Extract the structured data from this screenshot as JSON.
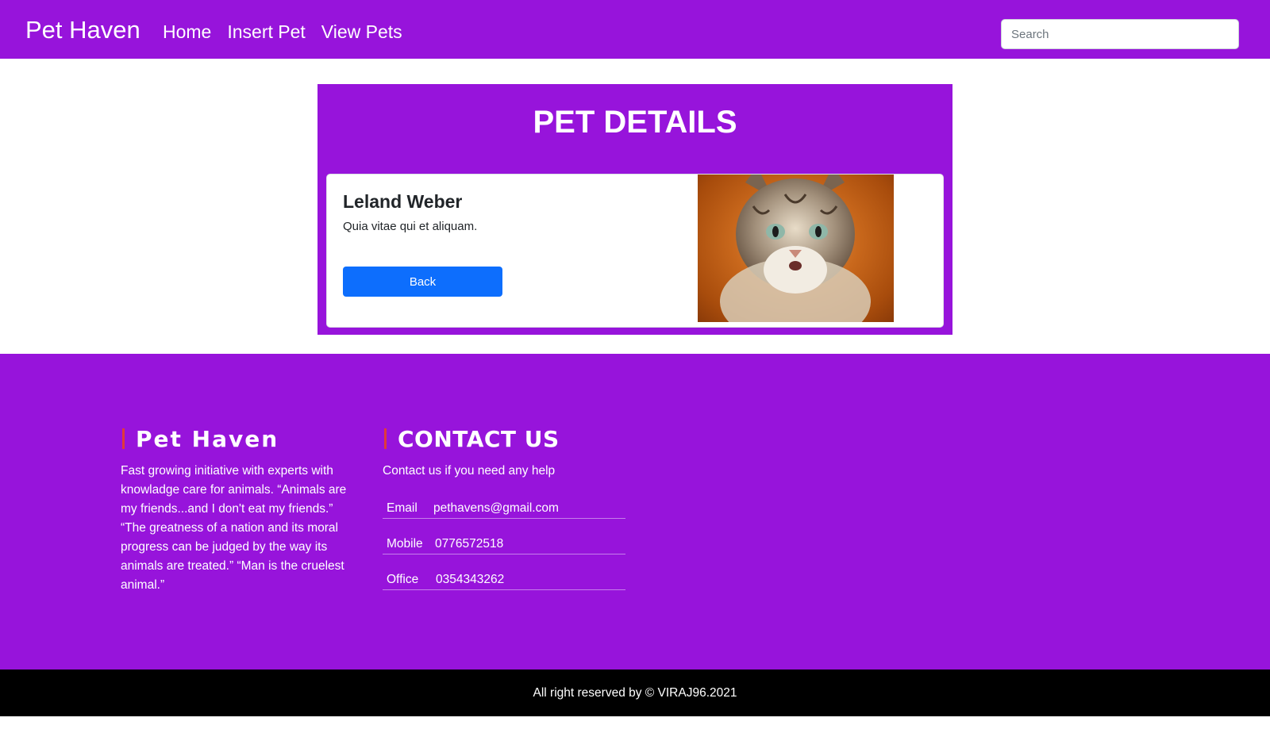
{
  "navbar": {
    "brand": "Pet Haven",
    "links": [
      "Home",
      "Insert Pet",
      "View Pets"
    ],
    "search_placeholder": "Search"
  },
  "details": {
    "title": "PET DETAILS",
    "pet": {
      "name": "Leland Weber",
      "description": "Quia vitae qui et aliquam.",
      "back_label": "Back"
    }
  },
  "footer": {
    "about": {
      "heading": "Pet Haven",
      "text": "Fast growing initiative with experts with knowladge care for animals. “Animals are my friends...and I don't eat my friends.” “The greatness of a nation and its moral progress can be judged by the way its animals are treated.” “Man is the cruelest animal.”"
    },
    "contact": {
      "heading": "CONTACT US",
      "intro": "Contact us if you need any help",
      "rows": [
        {
          "label": "Email",
          "value": "pethavens@gmail.com"
        },
        {
          "label": "Mobile",
          "value": "0776572518"
        },
        {
          "label": "Office",
          "value": "0354343262"
        }
      ]
    },
    "copyright": "All right reserved by © VIRAJ96.2021"
  },
  "colors": {
    "primary": "#9714db",
    "button": "#0d6efd",
    "accent_bar": "#e03a3a",
    "copyright_bg": "#000000"
  }
}
